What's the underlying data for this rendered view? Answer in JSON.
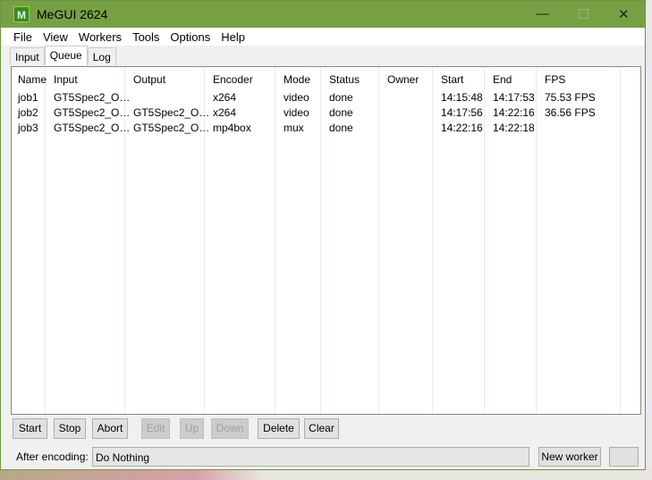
{
  "window": {
    "title": "MeGUI 2624",
    "logo": "megui-logo",
    "controls": [
      "minimize",
      "maximize",
      "close"
    ]
  },
  "menu": [
    "File",
    "View",
    "Workers",
    "Tools",
    "Options",
    "Help"
  ],
  "tabs": [
    {
      "label": "Input"
    },
    {
      "label": "Queue",
      "active": true
    },
    {
      "label": "Log"
    }
  ],
  "queue": {
    "columns": [
      "Name",
      "Input",
      "Output",
      "Encoder",
      "Mode",
      "Status",
      "Owner",
      "Start",
      "End",
      "FPS"
    ],
    "rows": [
      [
        "job1",
        "GT5Spec2_O…",
        "",
        "x264",
        "video",
        "done",
        "",
        "14:15:48",
        "14:17:53",
        "75.53 FPS"
      ],
      [
        "job2",
        "GT5Spec2_O…",
        "GT5Spec2_O…",
        "x264",
        "video",
        "done",
        "",
        "14:17:56",
        "14:22:16",
        "36.56 FPS"
      ],
      [
        "job3",
        "GT5Spec2_O…",
        "GT5Spec2_O…",
        "mp4box",
        "mux",
        "done",
        "",
        "14:22:16",
        "14:22:18",
        ""
      ]
    ]
  },
  "buttons": [
    {
      "label": "Start",
      "enabled": true
    },
    {
      "label": "Stop",
      "enabled": true
    },
    {
      "label": "Abort",
      "enabled": true
    },
    {
      "label": "Edit",
      "enabled": false
    },
    {
      "label": "Up",
      "enabled": false
    },
    {
      "label": "Down",
      "enabled": false
    },
    {
      "label": "Delete",
      "enabled": true
    },
    {
      "label": "Clear",
      "enabled": true
    }
  ],
  "after_encoding": {
    "label": "After encoding:",
    "value": "Do Nothing"
  },
  "new_worker_label": "New worker"
}
